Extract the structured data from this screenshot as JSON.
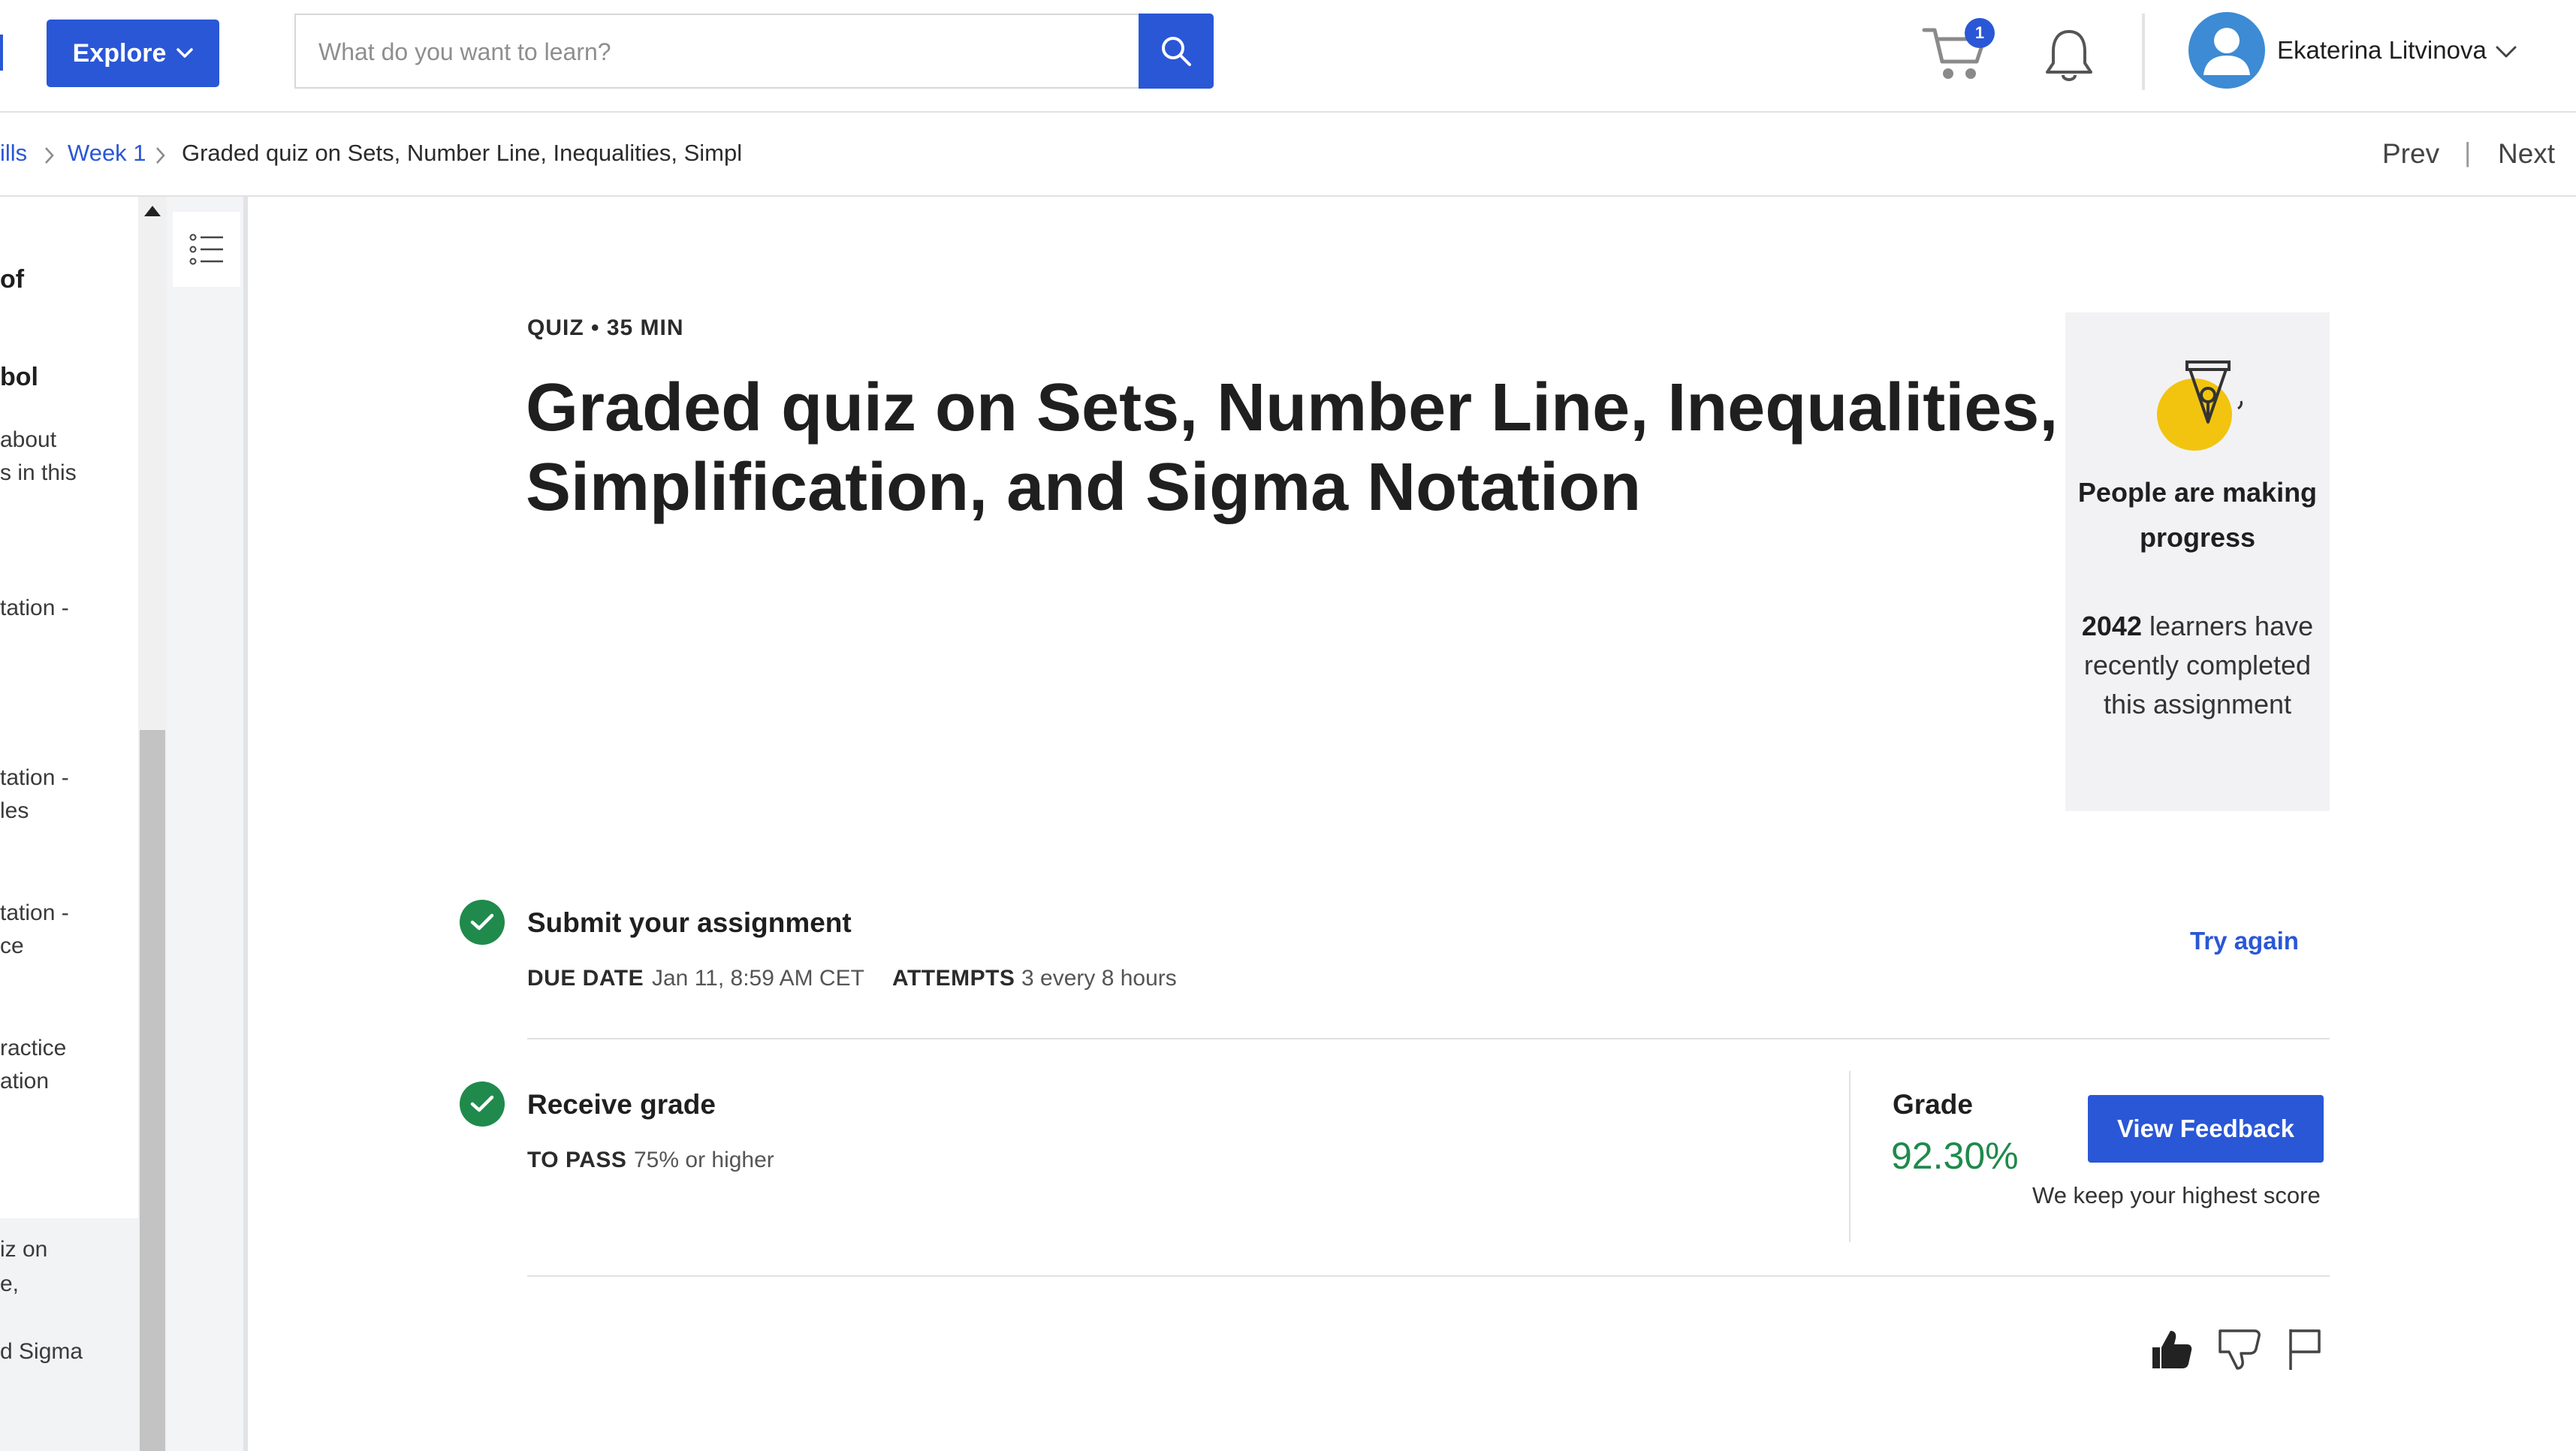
{
  "header": {
    "explore_label": "Explore",
    "search_placeholder": "What do you want to learn?",
    "cart_count": "1",
    "user_name": "Ekaterina Litvinova"
  },
  "breadcrumb": {
    "item0": "ills",
    "item1": "Week 1",
    "current": "Graded quiz on Sets, Number Line, Inequalities, Simpl",
    "prev": "Prev",
    "next": "Next",
    "divider": "|"
  },
  "sidebar": {
    "items": [
      {
        "text": "of"
      },
      {
        "text": "bol"
      },
      {
        "text": "about"
      },
      {
        "text": "s in this"
      },
      {
        "text": "tation -"
      },
      {
        "text": "tation -"
      },
      {
        "text": "les"
      },
      {
        "text": "tation -"
      },
      {
        "text": "ce"
      },
      {
        "text": "ractice"
      },
      {
        "text": "ation"
      },
      {
        "text": "iz on"
      },
      {
        "text": "e,"
      },
      {
        "text": "d Sigma"
      }
    ]
  },
  "main": {
    "meta": "QUIZ • 35 MIN",
    "title": "Graded quiz on Sets, Number Line, Inequalities, Simplification, and Sigma Notation",
    "progress_card": {
      "heading": "People are making progress",
      "learners": "2042",
      "body": "learners have recently completed this assignment"
    },
    "submit": {
      "title": "Submit your assignment",
      "due_label": "DUE DATE",
      "due_value": "Jan 11, 8:59 AM CET",
      "attempts_label": "ATTEMPTS",
      "attempts_value": "3 every 8 hours",
      "try_again": "Try again"
    },
    "receive": {
      "title": "Receive grade",
      "pass_label": "TO PASS",
      "pass_value": "75% or higher",
      "grade_label": "Grade",
      "grade_value": "92.30%",
      "view_feedback": "View Feedback",
      "keep_note": "We keep your highest score"
    }
  },
  "colors": {
    "brand_blue": "#2a57d6",
    "success_green": "#1f8a4c",
    "accent_yellow": "#f2c40f"
  },
  "icons": [
    "chevron-down-icon",
    "search-icon",
    "cart-icon",
    "bell-icon",
    "avatar-icon",
    "chevron-right-icon",
    "list-icon",
    "pen-icon",
    "check-icon",
    "thumbs-up-icon",
    "thumbs-down-icon",
    "flag-icon"
  ]
}
